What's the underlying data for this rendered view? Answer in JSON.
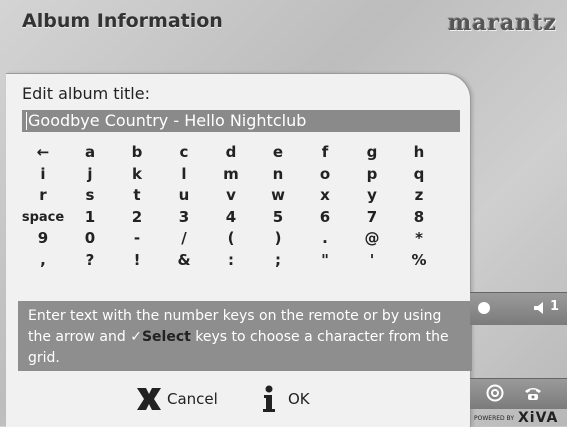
{
  "header": {
    "title": "Album Information",
    "brand": "marantz"
  },
  "editor": {
    "label": "Edit album title:",
    "value": "Goodbye Country - Hello Nightclub"
  },
  "keyboard": {
    "keys": [
      "←",
      "a",
      "b",
      "c",
      "d",
      "e",
      "f",
      "g",
      "h",
      "i",
      "j",
      "k",
      "l",
      "m",
      "n",
      "o",
      "p",
      "q",
      "r",
      "s",
      "t",
      "u",
      "v",
      "w",
      "x",
      "y",
      "z",
      "space",
      "1",
      "2",
      "3",
      "4",
      "5",
      "6",
      "7",
      "8",
      "9",
      "0",
      "-",
      "/",
      "(",
      ")",
      ".",
      "@",
      "*",
      ",",
      "?",
      "!",
      "&",
      ":",
      ";",
      "\"",
      "'",
      "%"
    ]
  },
  "help": {
    "part1": "Enter text with the number keys on the remote or by using the arrow and ",
    "check": "✓",
    "select": "Select",
    "part2": " keys to choose a character from the grid."
  },
  "buttons": {
    "cancel": "Cancel",
    "ok": "OK"
  },
  "status": {
    "volume": "1"
  },
  "footer": {
    "powered_by": "POWERED BY",
    "logo": "XiVA"
  },
  "icons": [
    "backspace-arrow-icon",
    "cancel-x-icon",
    "info-i-icon",
    "status-dot-icon",
    "speaker-icon",
    "disc-icon",
    "phone-icon"
  ]
}
